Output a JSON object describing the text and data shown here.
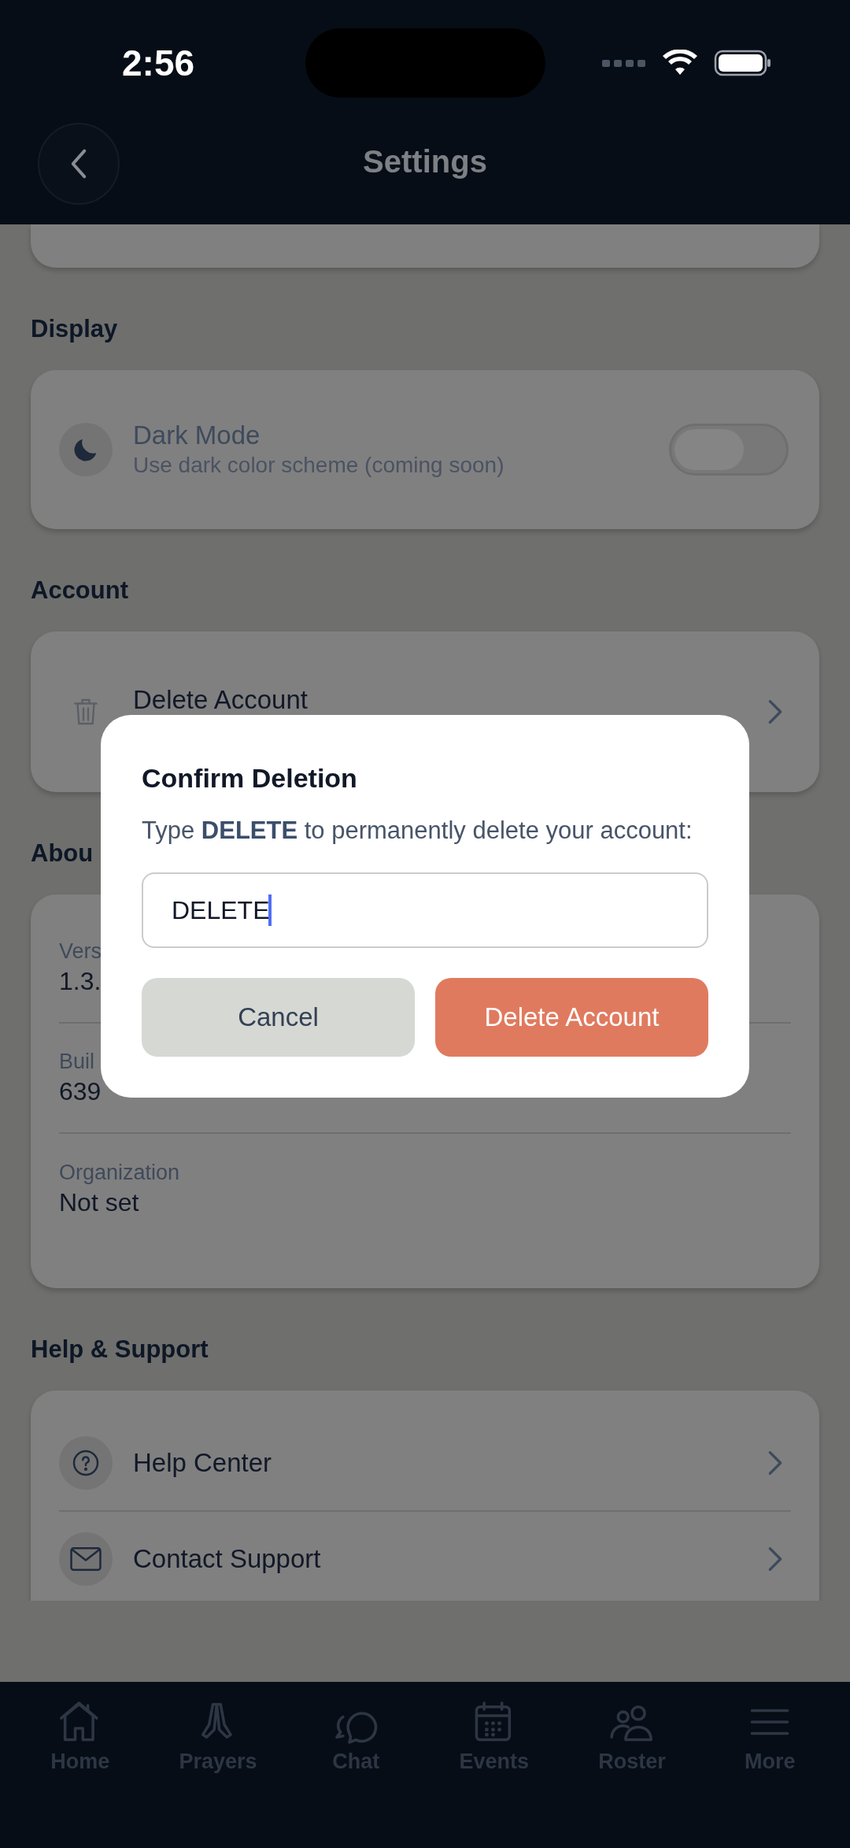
{
  "status_bar": {
    "time": "2:56"
  },
  "header": {
    "title": "Settings"
  },
  "sections": [
    {
      "title": "Display",
      "rows": [
        {
          "kind": "toggle",
          "title": "Dark Mode",
          "subtitle": "Use dark color scheme (coming soon)",
          "on": false
        }
      ]
    },
    {
      "title": "Account",
      "rows": [
        {
          "kind": "link",
          "title": "Delete Account"
        }
      ]
    },
    {
      "title": "Abou",
      "rows": [
        {
          "kind": "info",
          "label": "Vers",
          "value": "1.3."
        },
        {
          "kind": "info",
          "label": "Buil",
          "value": "639"
        },
        {
          "kind": "info",
          "label": "Organization",
          "value": "Not set"
        }
      ]
    },
    {
      "title": "Help & Support",
      "rows": [
        {
          "kind": "link",
          "title": "Help Center"
        },
        {
          "kind": "link",
          "title": "Contact Support"
        }
      ]
    }
  ],
  "dialog": {
    "title": "Confirm Deletion",
    "message": "Type **DELETE** to permanently delete your account:",
    "input": {
      "value": "DELETE"
    },
    "buttons": [
      {
        "kind": "secondary",
        "label": "Cancel"
      },
      {
        "kind": "destructive",
        "label": "Delete Account"
      }
    ]
  },
  "tabs": [
    {
      "label": "Home",
      "selected": false
    },
    {
      "label": "Prayers",
      "selected": false
    },
    {
      "label": "Chat",
      "selected": false
    },
    {
      "label": "Events",
      "selected": false
    },
    {
      "label": "Roster",
      "selected": false
    },
    {
      "label": "More",
      "selected": false
    }
  ]
}
